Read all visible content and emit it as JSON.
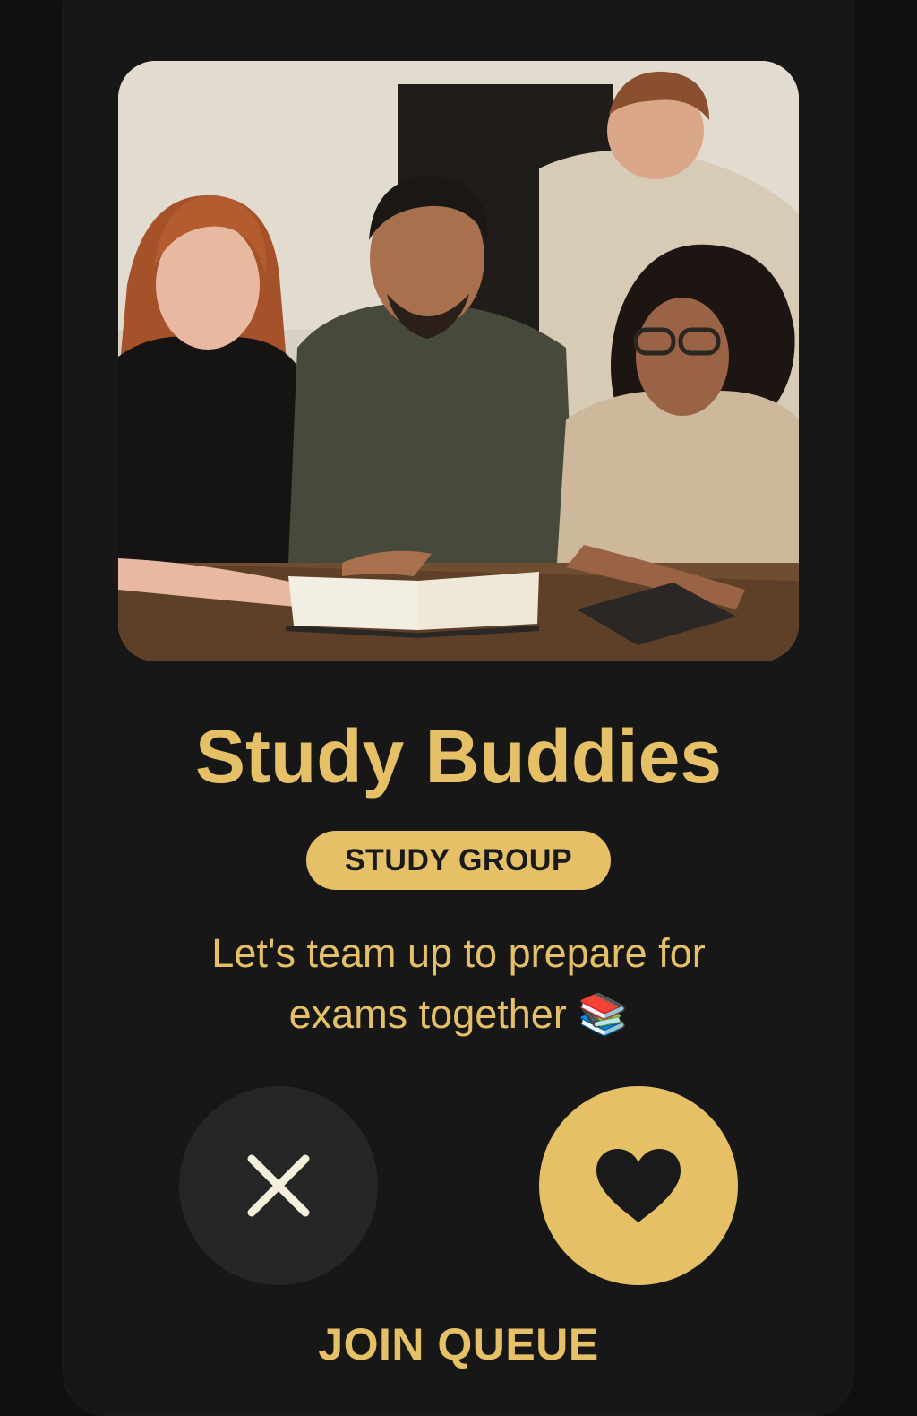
{
  "profile": {
    "photo_alt": "",
    "name": "Study Buddies",
    "category": "STUDY GROUP",
    "description_line1": "Let's team up to prepare for",
    "description_line2": "exams together 📚"
  },
  "actions": {
    "reject_icon": "close-icon",
    "like_icon": "heart-icon",
    "join_label": "JOIN QUEUE"
  },
  "colors": {
    "background": "#101010",
    "card": "#171717",
    "accent": "#e6c067",
    "reject_button": "#262626",
    "icon_light": "#f4f0dc",
    "icon_dark": "#1a1a1a"
  }
}
